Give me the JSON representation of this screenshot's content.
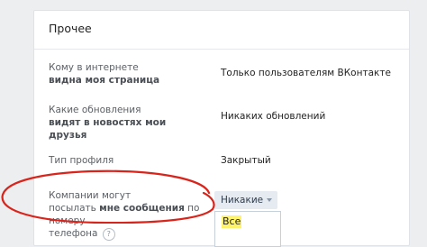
{
  "section": {
    "title": "Прочее"
  },
  "rows": [
    {
      "label_line1": "Кому в интернете",
      "label_line2_bold": "видна моя страница",
      "value": "Только пользователям ВКонтакте"
    },
    {
      "label_line1": "Какие обновления",
      "label_line2_bold": "видят в новостях мои друзья",
      "value": "Никаких обновлений"
    },
    {
      "label": "Тип профиля",
      "value": "Закрытый"
    },
    {
      "label_line1": "Компании могут",
      "label_line2_prefix": "посылать ",
      "label_line2_bold": "мне сообщения",
      "label_line2_suffix": " по номеру",
      "label_line3": "телефона",
      "help_icon_text": "?",
      "dropdown_value": "Никакие",
      "dropdown_option": "Все"
    }
  ],
  "colors": {
    "background": "#edeef0",
    "card": "#ffffff",
    "annotation_circle": "#d9241c",
    "highlight": "#fff36b"
  },
  "icons": {
    "help": "question-circle-icon",
    "dropdown": "caret-down-icon"
  }
}
